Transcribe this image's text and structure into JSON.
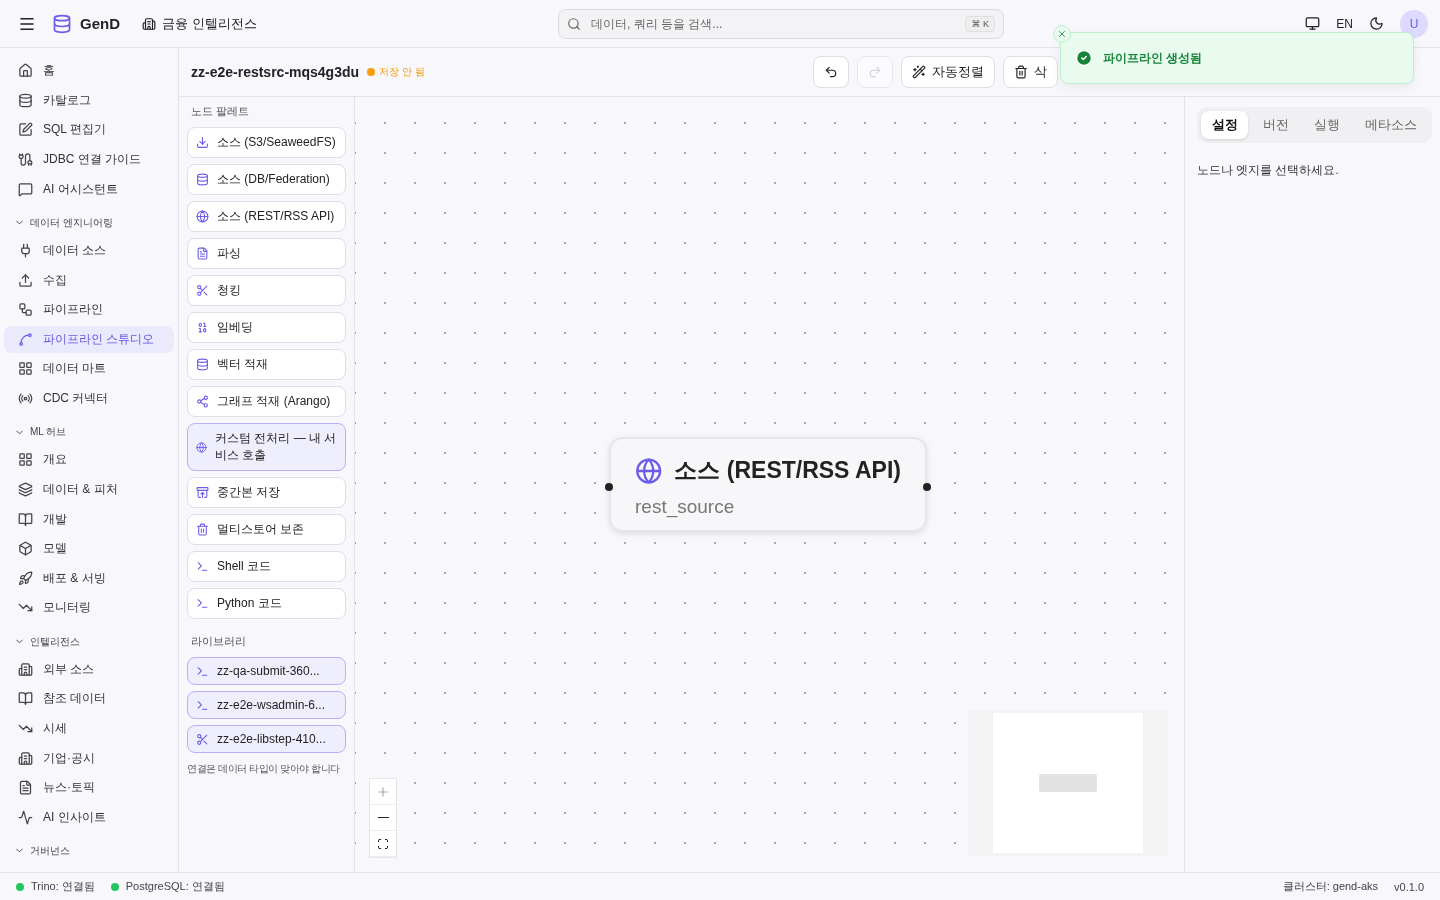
{
  "header": {
    "app_name": "GenD",
    "workspace": "금융 인텔리전스",
    "search": {
      "placeholder": "데이터, 쿼리 등을 검색...",
      "shortcut": "⌘ K"
    },
    "language": "EN",
    "avatar": "U"
  },
  "sidebar": {
    "items": [
      {
        "label": "홈",
        "selected": false
      },
      {
        "label": "카탈로그",
        "selected": false
      },
      {
        "label": "SQL 편집기",
        "selected": false
      },
      {
        "label": "JDBC 연결 가이드",
        "selected": false
      },
      {
        "label": "AI 어시스턴트",
        "selected": false
      }
    ],
    "groups": [
      {
        "title": "데이터 엔지니어링",
        "expanded": true,
        "items": [
          {
            "label": "데이터 소스",
            "selected": false
          },
          {
            "label": "수집",
            "selected": false
          },
          {
            "label": "파이프라인",
            "selected": false
          },
          {
            "label": "파이프라인 스튜디오",
            "selected": true
          },
          {
            "label": "데이터 마트",
            "selected": false
          },
          {
            "label": "CDC 커넥터",
            "selected": false
          }
        ]
      },
      {
        "title": "ML 허브",
        "expanded": true,
        "items": [
          {
            "label": "개요",
            "selected": false
          },
          {
            "label": "데이터 & 피처",
            "selected": false
          },
          {
            "label": "개발",
            "selected": false
          },
          {
            "label": "모델",
            "selected": false
          },
          {
            "label": "배포 & 서빙",
            "selected": false
          },
          {
            "label": "모니터링",
            "selected": false
          }
        ]
      },
      {
        "title": "인텔리전스",
        "expanded": true,
        "items": [
          {
            "label": "외부 소스",
            "selected": false
          },
          {
            "label": "참조 데이터",
            "selected": false
          },
          {
            "label": "시세",
            "selected": false
          },
          {
            "label": "기업·공시",
            "selected": false
          },
          {
            "label": "뉴스·토픽",
            "selected": false
          },
          {
            "label": "AI 인사이트",
            "selected": false
          }
        ]
      },
      {
        "title": "거버넌스",
        "expanded": true
      }
    ]
  },
  "pipeline": {
    "name": "zz-e2e-restsrc-mqs4g3du",
    "status": "저장 안 됨",
    "saved": false
  },
  "toolbar": [
    {
      "kind": "undo",
      "disabled": false
    },
    {
      "kind": "redo",
      "disabled": true
    },
    {
      "kind": "text",
      "label": "자동정렬"
    },
    {
      "kind": "text",
      "label": "삭"
    }
  ],
  "palette": {
    "title": "노드 팔레트",
    "nodes": [
      {
        "label": "소스 (S3/SeaweedFS)",
        "kind": "builtin"
      },
      {
        "label": "소스 (DB/Federation)",
        "kind": "builtin"
      },
      {
        "label": "소스 (REST/RSS API)",
        "kind": "builtin"
      },
      {
        "label": "파싱",
        "kind": "builtin"
      },
      {
        "label": "청킹",
        "kind": "builtin"
      },
      {
        "label": "임베딩",
        "kind": "builtin"
      },
      {
        "label": "벡터 적재",
        "kind": "builtin"
      },
      {
        "label": "그래프 적재 (Arango)",
        "kind": "builtin"
      },
      {
        "label": "커스텀 전처리 — 내 서비스 호출",
        "kind": "custom"
      },
      {
        "label": "중간본 저장",
        "kind": "builtin"
      },
      {
        "label": "멀티스토어 보존",
        "kind": "builtin"
      },
      {
        "label": "Shell 코드",
        "kind": "builtin"
      },
      {
        "label": "Python 코드",
        "kind": "builtin"
      }
    ],
    "library_title": "라이브러리",
    "library": [
      {
        "label": "zz-qa-submit-360...",
        "kind": "shell"
      },
      {
        "label": "zz-e2e-wsadmin-6...",
        "kind": "shell"
      },
      {
        "label": "zz-e2e-libstep-410...",
        "kind": "scissors"
      }
    ],
    "hint": "연결은 데이터 타입이 맞아야 합니다"
  },
  "canvas": {
    "nodes": [
      {
        "title": "소스 (REST/RSS API)",
        "subtitle": "rest_source"
      }
    ]
  },
  "panel": {
    "tabs": [
      {
        "label": "설정",
        "selected": true
      },
      {
        "label": "버전",
        "selected": false
      },
      {
        "label": "실행",
        "selected": false
      },
      {
        "label": "메타소스",
        "selected": false
      }
    ],
    "empty_message": "노드나 엣지를 선택하세요."
  },
  "toast": {
    "message": "파이프라인 생성됨",
    "kind": "success"
  },
  "status_bar": {
    "connections": [
      {
        "label": "Trino: 연결됨",
        "color": "#22c55e"
      },
      {
        "label": "PostgreSQL: 연결됨",
        "color": "#22c55e"
      }
    ],
    "cluster": "클러스터: gend-aks",
    "version": "v0.1.0"
  }
}
